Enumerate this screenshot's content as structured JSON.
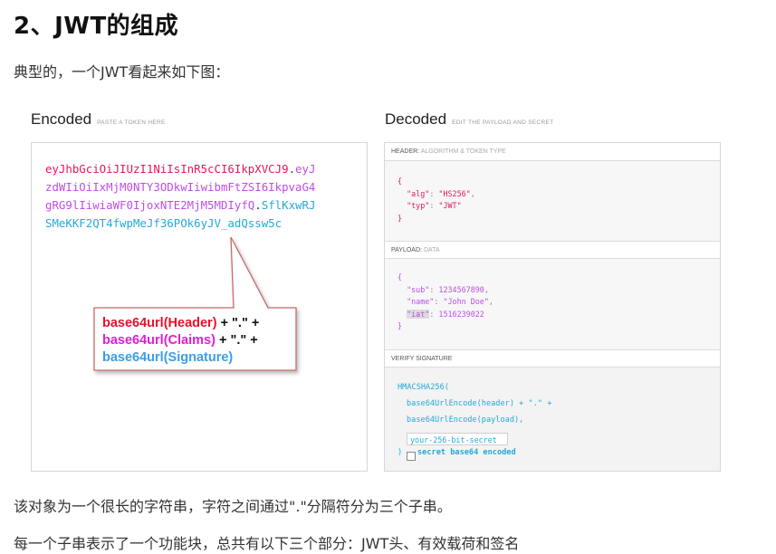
{
  "article": {
    "title": "2、JWT的组成",
    "intro": "典型的，一个JWT看起来如下图：",
    "outro1": "该对象为一个很长的字符串，字符之间通过\".\"分隔符分为三个子串。",
    "outro2": "每一个子串表示了一个功能块，总共有以下三个部分：JWT头、有效载荷和签名"
  },
  "encoded": {
    "title": "Encoded",
    "subtitle": "PASTE A TOKEN HERE",
    "token_lines": [
      [
        {
          "t": "eyJhbGciOiJIUzI1NiIsInR5cCI6IkpXVCJ9",
          "c": "red"
        },
        {
          "t": ".",
          "c": "black"
        },
        {
          "t": "eyJ",
          "c": "pur"
        }
      ],
      [
        {
          "t": "zdWIiOiIxMjM0NTY3ODkwIiwibmFtZSI6IkpvaG4",
          "c": "pur"
        }
      ],
      [
        {
          "t": "gRG9lIiwiaWF0IjoxNTE2MjM5MDIyfQ",
          "c": "pur"
        },
        {
          "t": ".",
          "c": "black"
        },
        {
          "t": "SflKxwRJ",
          "c": "cyan"
        }
      ],
      [
        {
          "t": "SMeKKF2QT4fwpMeJf36POk6yJV_adQssw5c",
          "c": "cyan"
        }
      ]
    ]
  },
  "callout": {
    "line1_part": "base64url(Header)",
    "line1_rest": " + \".\" +",
    "line2_part": "base64url(Claims)",
    "line2_rest": " + \".\" +",
    "line3_part": "base64url(Signature)"
  },
  "decoded": {
    "title": "Decoded",
    "subtitle": "EDIT THE PAYLOAD AND SECRET",
    "header_label": "HEADER:",
    "header_sub": "ALGORITHM & TOKEN TYPE",
    "header_json": {
      "alg": "HS256",
      "typ": "JWT"
    },
    "payload_label": "PAYLOAD:",
    "payload_sub": "DATA",
    "payload_json": {
      "sub": "1234567890",
      "name": "John Doe",
      "iat": "1516239022"
    },
    "verify_label": "VERIFY SIGNATURE",
    "sig_line1": "HMACSHA256(",
    "sig_line2": "base64UrlEncode(header) + \".\" +",
    "sig_line3": "base64UrlEncode(payload),",
    "secret_value": "your-256-bit-secret",
    "close_paren": ")",
    "b64_label": "secret base64 encoded"
  },
  "colors": {
    "header": "#e6175c",
    "payload": "#c04ce8",
    "signature": "#22aad8"
  }
}
